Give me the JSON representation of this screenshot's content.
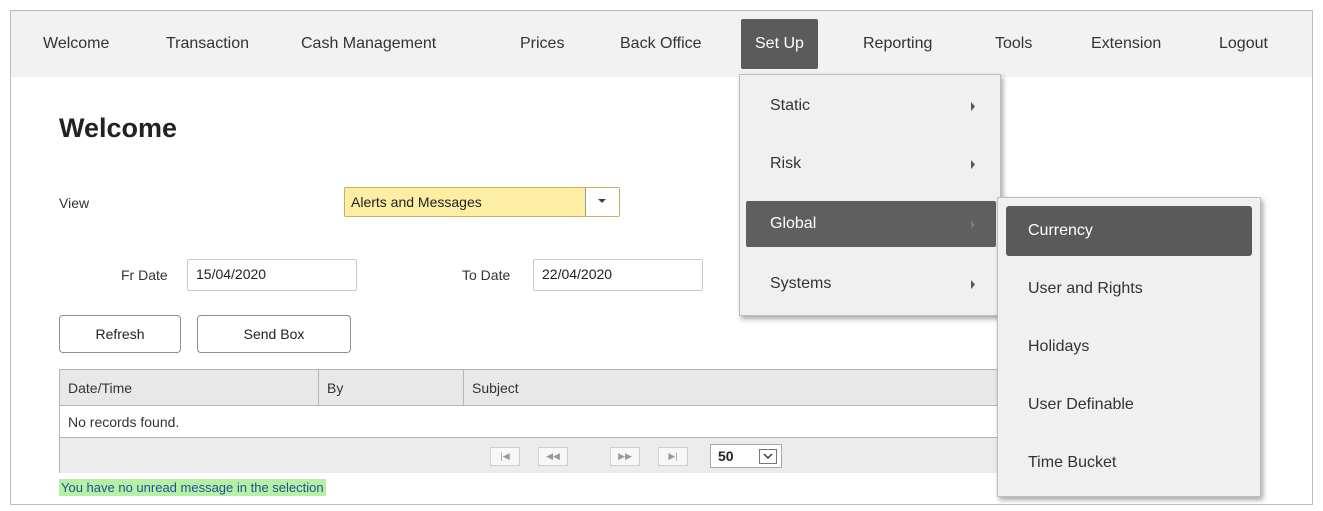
{
  "menubar": {
    "items": [
      {
        "label": "Welcome"
      },
      {
        "label": "Transaction"
      },
      {
        "label": "Cash Management"
      },
      {
        "label": "Prices"
      },
      {
        "label": "Back Office"
      },
      {
        "label": "Set Up"
      },
      {
        "label": "Reporting"
      },
      {
        "label": "Tools"
      },
      {
        "label": "Extension"
      },
      {
        "label": "Logout"
      }
    ],
    "active": "Set Up"
  },
  "page": {
    "title": "Welcome",
    "view_label": "View",
    "view_value": "Alerts and Messages",
    "fr_date_label": "Fr Date",
    "fr_date_value": "15/04/2020",
    "to_date_label": "To Date",
    "to_date_value": "22/04/2020",
    "refresh_label": "Refresh",
    "sendbox_label": "Send Box"
  },
  "grid": {
    "columns": [
      "Date/Time",
      "By",
      "Subject"
    ],
    "empty_text": "No records found.",
    "pager": {
      "first": "|◀",
      "prev": "◀◀",
      "next": "▶▶",
      "last": "▶|",
      "page_size": "50"
    }
  },
  "status_message": "You have no unread message in the selection",
  "setup_menu": {
    "items": [
      {
        "label": "Static"
      },
      {
        "label": "Risk"
      },
      {
        "label": "Global"
      },
      {
        "label": "Systems"
      }
    ],
    "active": "Global"
  },
  "global_submenu": {
    "items": [
      {
        "label": "Currency"
      },
      {
        "label": "User and Rights"
      },
      {
        "label": "Holidays"
      },
      {
        "label": "User Definable"
      },
      {
        "label": "Time Bucket"
      }
    ],
    "active": "Currency"
  },
  "colors": {
    "menubar_bg": "#f2f2f2",
    "active_menu_bg": "#5b5b5b",
    "select_highlight": "#fdeea3",
    "status_bg": "#b5f1a5",
    "status_text": "#1f4f9a"
  }
}
